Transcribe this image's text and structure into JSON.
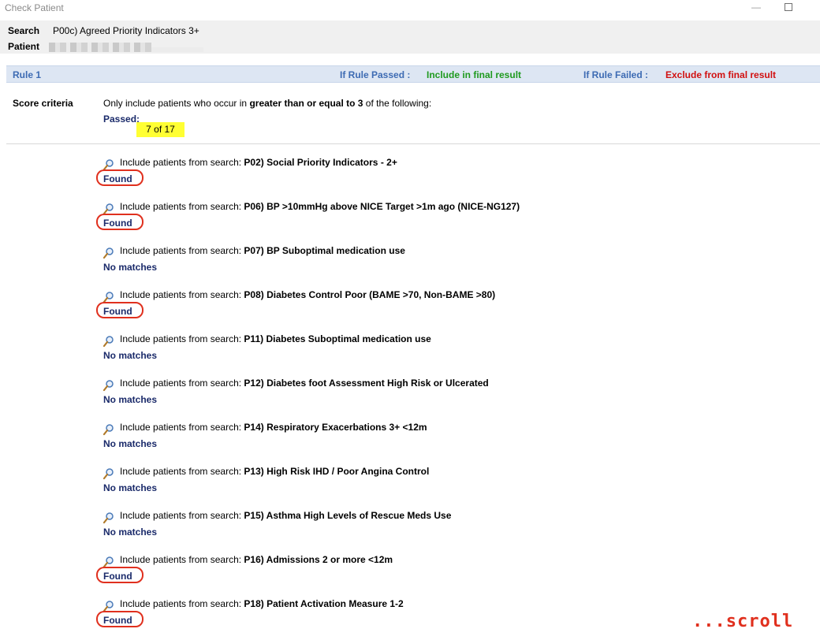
{
  "window": {
    "title": "Check Patient"
  },
  "header": {
    "search_label": "Search",
    "search_value": "P00c) Agreed Priority Indicators 3+",
    "patient_label": "Patient"
  },
  "rule": {
    "name": "Rule 1",
    "if_passed_label": "If Rule Passed :",
    "if_passed_value": "Include in final result",
    "if_failed_label": "If Rule Failed :",
    "if_failed_value": "Exclude from final result"
  },
  "score": {
    "label": "Score criteria",
    "text_prefix": "Only include patients who occur in ",
    "text_bold": "greater than or equal to 3",
    "text_suffix": "  of the following:",
    "passed_label": "Passed:",
    "passed_value": "7 of 17"
  },
  "items": [
    {
      "prefix": "Include patients from search: ",
      "name": "P02) Social Priority Indicators - 2+",
      "result": "Found"
    },
    {
      "prefix": "Include patients from search: ",
      "name": "P06) BP >10mmHg above NICE Target >1m ago (NICE-NG127)",
      "result": "Found"
    },
    {
      "prefix": "Include patients from search: ",
      "name": "P07) BP Suboptimal medication use",
      "result": "No matches"
    },
    {
      "prefix": "Include patients from search: ",
      "name": "P08) Diabetes Control Poor (BAME >70, Non-BAME >80)",
      "result": "Found"
    },
    {
      "prefix": "Include patients from search: ",
      "name": "P11) Diabetes Suboptimal medication use",
      "result": "No matches"
    },
    {
      "prefix": "Include patients from search: ",
      "name": "P12) Diabetes foot Assessment High Risk or Ulcerated",
      "result": "No matches"
    },
    {
      "prefix": "Include patients from search: ",
      "name": "P14) Respiratory Exacerbations 3+ <12m",
      "result": "No matches"
    },
    {
      "prefix": "Include patients from search: ",
      "name": "P13) High Risk IHD / Poor Angina Control",
      "result": "No matches"
    },
    {
      "prefix": "Include patients from search: ",
      "name": "P15) Asthma High Levels of Rescue Meds Use",
      "result": "No matches"
    },
    {
      "prefix": "Include patients from search: ",
      "name": "P16) Admissions 2 or more <12m",
      "result": "Found"
    },
    {
      "prefix": "Include patients from search: ",
      "name": "P18) Patient Activation Measure 1-2",
      "result": "Found"
    }
  ],
  "annotation": {
    "scroll_note": "...scroll"
  },
  "icons": {
    "item_icon": "magnifier-icon",
    "minimize": "minimize-icon",
    "maximize": "maximize-icon"
  },
  "colors": {
    "rule_bar": "#dde6f3",
    "passed_highlight": "#ffff33",
    "found_ring": "#e0301e",
    "result_text": "#1a2a6a"
  }
}
